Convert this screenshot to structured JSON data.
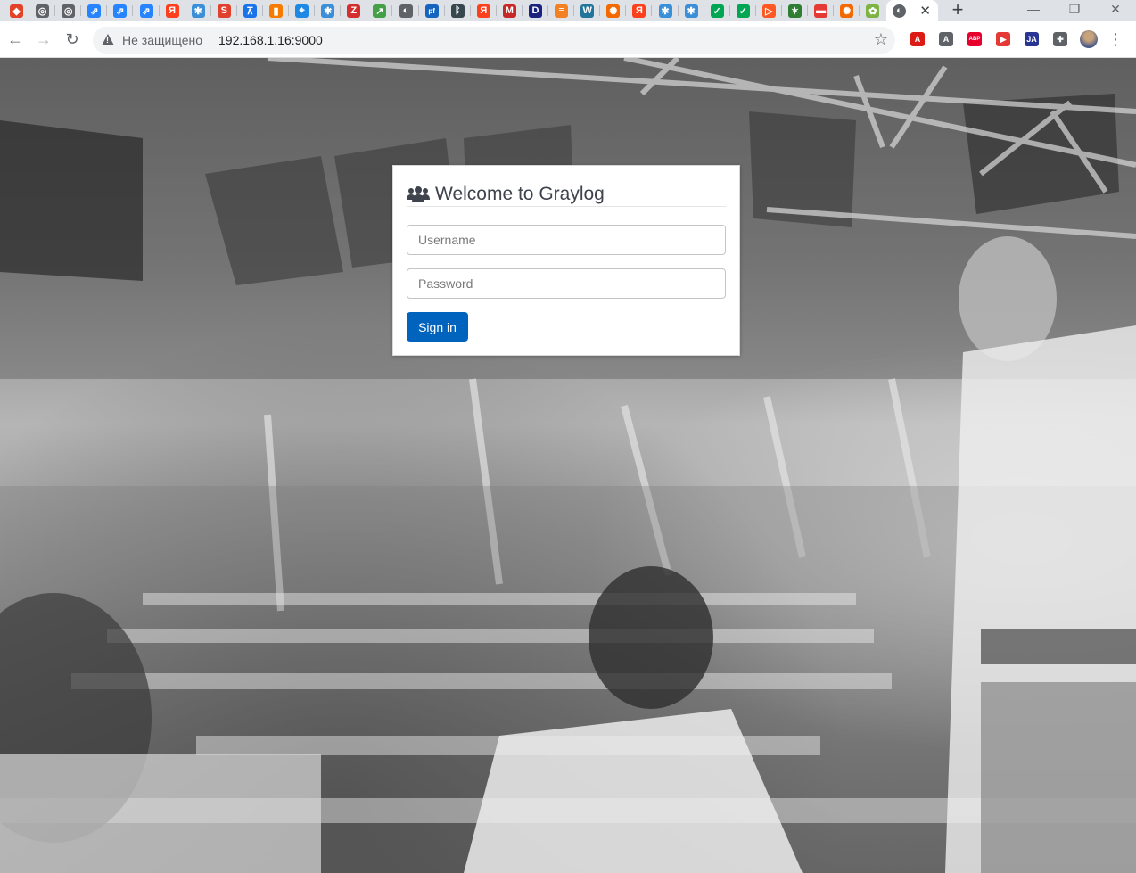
{
  "browser": {
    "tabs": [
      {
        "icon": "gitlab-icon",
        "color": "#e24329",
        "glyph": "◆"
      },
      {
        "icon": "globe-settings-icon",
        "color": "#5f6368",
        "glyph": "◎"
      },
      {
        "icon": "globe-settings-icon",
        "color": "#5f6368",
        "glyph": "◎"
      },
      {
        "icon": "jira-icon",
        "color": "#2684ff",
        "glyph": "⇗"
      },
      {
        "icon": "jira-icon",
        "color": "#2684ff",
        "glyph": "⇗"
      },
      {
        "icon": "jira-icon",
        "color": "#2684ff",
        "glyph": "⇗"
      },
      {
        "icon": "yandex-icon",
        "color": "#fc3f1d",
        "glyph": "Я"
      },
      {
        "icon": "gear-app-icon",
        "color": "#3b8fd9",
        "glyph": "✱"
      },
      {
        "icon": "s-app-icon",
        "color": "#e0402e",
        "glyph": "S"
      },
      {
        "icon": "cart-icon",
        "color": "#1a73e8",
        "glyph": "⊼"
      },
      {
        "icon": "orange-app-icon",
        "color": "#f57c00",
        "glyph": "▮"
      },
      {
        "icon": "pin-app-icon",
        "color": "#1e88e5",
        "glyph": "⌖"
      },
      {
        "icon": "gear-app-icon",
        "color": "#3b8fd9",
        "glyph": "✱"
      },
      {
        "icon": "z-app-icon",
        "color": "#d32f2f",
        "glyph": "Z"
      },
      {
        "icon": "chart-app-icon",
        "color": "#43a047",
        "glyph": "↗"
      },
      {
        "icon": "globe-icon",
        "color": "#5f6368",
        "glyph": "◐"
      },
      {
        "icon": "pf-app-icon",
        "color": "#1565c0",
        "glyph": "pf"
      },
      {
        "icon": "bluetooth-icon",
        "color": "#37474f",
        "glyph": "ᛒ"
      },
      {
        "icon": "yandex-icon",
        "color": "#fc3f1d",
        "glyph": "Я"
      },
      {
        "icon": "m-app-icon",
        "color": "#c62828",
        "glyph": "M"
      },
      {
        "icon": "d-app-icon",
        "color": "#1a237e",
        "glyph": "D"
      },
      {
        "icon": "stackoverflow-icon",
        "color": "#f48024",
        "glyph": "≡"
      },
      {
        "icon": "wordpress-icon",
        "color": "#21759b",
        "glyph": "W"
      },
      {
        "icon": "grafana-icon",
        "color": "#f46800",
        "glyph": "✺"
      },
      {
        "icon": "yandex-icon",
        "color": "#fc3f1d",
        "glyph": "Я"
      },
      {
        "icon": "gear-app-icon",
        "color": "#3b8fd9",
        "glyph": "✱"
      },
      {
        "icon": "gear-app-icon",
        "color": "#3b8fd9",
        "glyph": "✱"
      },
      {
        "icon": "veeam-icon",
        "color": "#00a651",
        "glyph": "✓"
      },
      {
        "icon": "veeam-icon",
        "color": "#00a651",
        "glyph": "✓"
      },
      {
        "icon": "arrow-app-icon",
        "color": "#ff5722",
        "glyph": "▷"
      },
      {
        "icon": "star-app-icon",
        "color": "#2e7d32",
        "glyph": "✶"
      },
      {
        "icon": "red-app-icon",
        "color": "#e53935",
        "glyph": "▬"
      },
      {
        "icon": "grafana-icon",
        "color": "#f46800",
        "glyph": "✺"
      },
      {
        "icon": "flower-app-icon",
        "color": "#7cb342",
        "glyph": "✿"
      }
    ],
    "active_tab_icon": "globe-icon",
    "omnibox": {
      "security_label": "Не защищено",
      "url": "192.168.1.16:9000"
    },
    "extensions": [
      {
        "icon": "angular-icon",
        "color": "#dd1b16",
        "glyph": "A"
      },
      {
        "icon": "a-ext-icon",
        "color": "#5f6368",
        "glyph": "A"
      },
      {
        "icon": "adblock-icon",
        "color": "#e8002d",
        "glyph": "ABP"
      },
      {
        "icon": "media-ext-icon",
        "color": "#e53935",
        "glyph": "▶"
      },
      {
        "icon": "ja-ext-icon",
        "color": "#283593",
        "glyph": "JA"
      },
      {
        "icon": "puzzle-icon",
        "color": "#5f6368",
        "glyph": "✚"
      }
    ]
  },
  "login": {
    "title": "Welcome to Graylog",
    "username_placeholder": "Username",
    "password_placeholder": "Password",
    "signin_label": "Sign in",
    "accent_color": "#0063be"
  }
}
